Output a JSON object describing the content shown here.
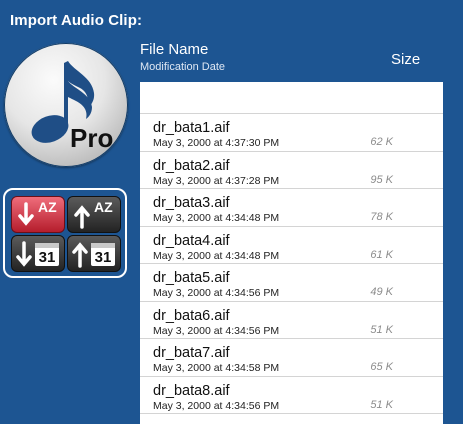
{
  "title": "Import Audio Clip:",
  "headers": {
    "file_name": "File Name",
    "modification_date": "Modification Date",
    "size": "Size"
  },
  "logo": {
    "text": "Pro",
    "icon": "music-note-icon"
  },
  "sort_buttons": [
    {
      "name": "sort-name-descending-button",
      "label": "AZ",
      "icon": "arrow-down-icon",
      "active": true
    },
    {
      "name": "sort-name-ascending-button",
      "label": "AZ",
      "icon": "arrow-up-icon",
      "active": false
    },
    {
      "name": "sort-date-descending-button",
      "label": "31",
      "icon": "calendar-icon",
      "active": false
    },
    {
      "name": "sort-date-ascending-button",
      "label": "31",
      "icon": "calendar-icon",
      "active": false
    }
  ],
  "files": [
    {
      "name": "dr_bata1.aif",
      "date": "May 3, 2000 at 4:37:30 PM",
      "size": "62 K"
    },
    {
      "name": "dr_bata2.aif",
      "date": "May 3, 2000 at 4:37:28 PM",
      "size": "95 K"
    },
    {
      "name": "dr_bata3.aif",
      "date": "May 3, 2000 at 4:34:48 PM",
      "size": "78 K"
    },
    {
      "name": "dr_bata4.aif",
      "date": "May 3, 2000 at 4:34:48 PM",
      "size": "61 K"
    },
    {
      "name": "dr_bata5.aif",
      "date": "May 3, 2000 at 4:34:56 PM",
      "size": "49 K"
    },
    {
      "name": "dr_bata6.aif",
      "date": "May 3, 2000 at 4:34:56 PM",
      "size": "51 K"
    },
    {
      "name": "dr_bata7.aif",
      "date": "May 3, 2000 at 4:34:58 PM",
      "size": "65 K"
    },
    {
      "name": "dr_bata8.aif",
      "date": "May 3, 2000 at 4:34:56 PM",
      "size": "51 K"
    }
  ]
}
